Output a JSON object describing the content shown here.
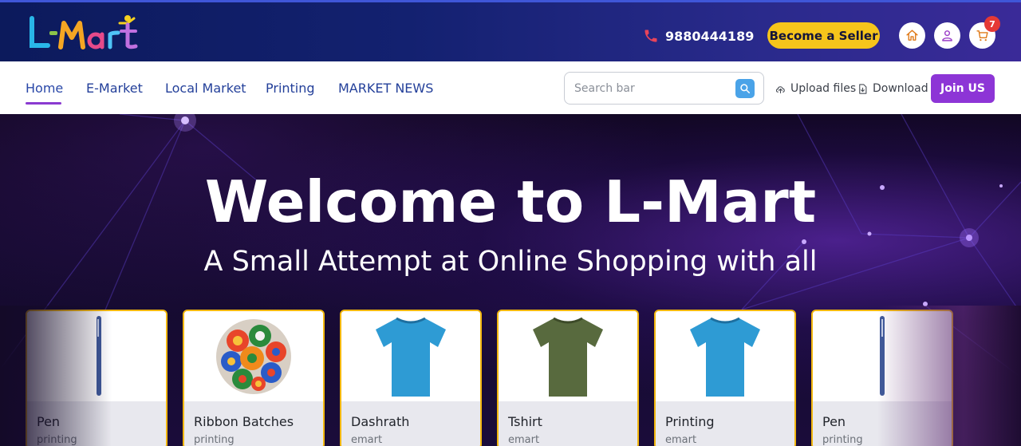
{
  "header": {
    "logo_text": "L-Mart",
    "phone": "9880444189",
    "seller_button": "Become a Seller",
    "cart_count": "7",
    "icons": [
      "phone-icon",
      "home-icon",
      "user-icon",
      "cart-icon"
    ]
  },
  "nav": {
    "links": [
      "Home",
      "E-Market",
      "Local Market",
      "Printing",
      "MARKET NEWS"
    ],
    "active": "Home",
    "search_placeholder": "Search bar",
    "upload_label": "Upload files",
    "download_label": "Download",
    "join_button": "Join US"
  },
  "hero": {
    "title": "Welcome to L-Mart",
    "subtitle": "A Small Attempt at Online Shopping with all"
  },
  "products": [
    {
      "name": "Pen",
      "category": "printing",
      "image": "pen"
    },
    {
      "name": "Ribbon Batches",
      "category": "printing",
      "image": "ribbon-badges"
    },
    {
      "name": "Dashrath",
      "category": "emart",
      "image": "blue-tshirt"
    },
    {
      "name": "Tshirt",
      "category": "emart",
      "image": "olive-tshirt"
    },
    {
      "name": "Printing",
      "category": "emart",
      "image": "blue-tshirt"
    },
    {
      "name": "Pen",
      "category": "printing",
      "image": "pen"
    }
  ],
  "colors": {
    "accent": "#8d35d6",
    "seller_yellow": "#f6c51b",
    "card_border": "#f2b70f",
    "nav_link": "#24409a",
    "header_dark": "#132170"
  }
}
